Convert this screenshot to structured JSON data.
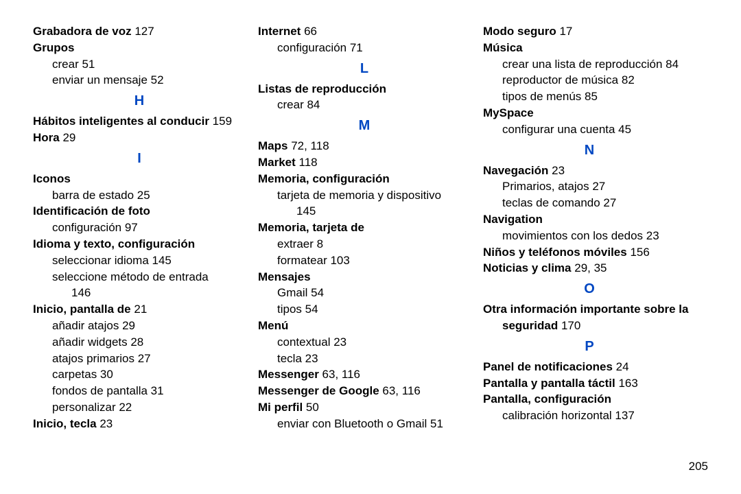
{
  "page_number": "205",
  "column1": {
    "grabadora_voz_label": "Grabadora de voz",
    "grabadora_voz_page": " 127",
    "grupos_label": "Grupos",
    "grupos_crear": "crear 51",
    "grupos_enviar": "enviar un mensaje 52",
    "letter_H": "H",
    "habitos_label": "Hábitos inteligentes al conducir",
    "habitos_page": " 159",
    "hora_label": "Hora",
    "hora_page": " 29",
    "letter_I": "I",
    "iconos_label": "Iconos",
    "iconos_barra": "barra de estado 25",
    "ident_foto_label": "Identificación de foto",
    "ident_foto_config": "configuración 97",
    "idioma_texto_label": "Idioma y texto, configuración",
    "idioma_sel": "seleccionar idioma 145",
    "idioma_metodo_line": "seleccione método de entrada",
    "idioma_metodo_cont": "146",
    "inicio_pant_label": "Inicio, pantalla de",
    "inicio_pant_page": " 21",
    "inicio_pant_atajos": "añadir atajos 29",
    "inicio_pant_widgets": "añadir widgets 28",
    "inicio_pant_primarios": "atajos primarios 27",
    "inicio_pant_carpetas": "carpetas 30",
    "inicio_pant_fondos": "fondos de pantalla 31",
    "inicio_pant_personalizar": "personalizar 22",
    "inicio_tecla_label": "Inicio, tecla",
    "inicio_tecla_page": " 23"
  },
  "column2": {
    "internet_label": "Internet",
    "internet_page": " 66",
    "internet_config": "configuración 71",
    "letter_L": "L",
    "listas_label": "Listas de reproducción",
    "listas_crear": "crear 84",
    "letter_M": "M",
    "maps_label": "Maps",
    "maps_page": " 72, 118",
    "market_label": "Market",
    "market_page": " 118",
    "memoria_config_label": "Memoria, configuración",
    "memoria_config_line": "tarjeta de memoria y dispositivo",
    "memoria_config_cont": "145",
    "memoria_tarjeta_label": "Memoria, tarjeta de",
    "memoria_tarjeta_extraer": "extraer 8",
    "memoria_tarjeta_formatear": "formatear 103",
    "mensajes_label": "Mensajes",
    "mensajes_gmail": "Gmail 54",
    "mensajes_tipos": "tipos 54",
    "menu_label": "Menú",
    "menu_contextual": "contextual 23",
    "menu_tecla": "tecla 23",
    "messenger_label": "Messenger",
    "messenger_page": " 63, 116",
    "messenger_google_label": "Messenger de Google",
    "messenger_google_page": " 63, 116",
    "miperfil_label": "Mi perfil",
    "miperfil_page": " 50",
    "miperfil_enviar": "enviar con Bluetooth o Gmail 51"
  },
  "column3": {
    "modo_seguro_label": "Modo seguro",
    "modo_seguro_page": " 17",
    "musica_label": "Música",
    "musica_crear": "crear una lista de reproducción 84",
    "musica_reproductor": "reproductor de música 82",
    "musica_tipos": "tipos de menús 85",
    "myspace_label": "MySpace",
    "myspace_config": "configurar una cuenta 45",
    "letter_N": "N",
    "navegacion_label": "Navegación",
    "navegacion_page": " 23",
    "navegacion_primarios": "Primarios, atajos 27",
    "navegacion_teclas": "teclas de comando 27",
    "navigation_label": "Navigation",
    "navigation_mov": "movimientos con los dedos 23",
    "ninos_label": "Niños y teléfonos móviles",
    "ninos_page": " 156",
    "noticias_label": "Noticias y clima",
    "noticias_page": " 29, 35",
    "letter_O": "O",
    "otra_line": "Otra información importante sobre la",
    "otra_line2_bold": "seguridad",
    "otra_line2_page": " 170",
    "letter_P": "P",
    "panel_notif_label": "Panel de notificaciones",
    "panel_notif_page": " 24",
    "pantalla_tactil_label": "Pantalla y pantalla táctil",
    "pantalla_tactil_page": " 163",
    "pantalla_config_label": "Pantalla, configuración",
    "pantalla_calib": "calibración horizontal 137"
  }
}
